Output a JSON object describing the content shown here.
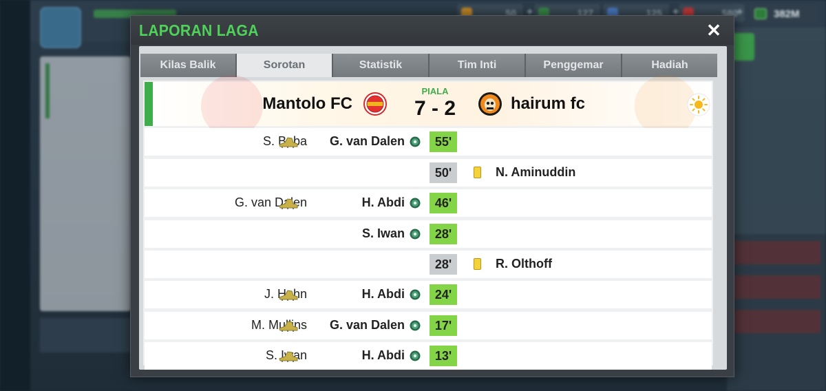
{
  "background": {
    "resources": [
      {
        "value": "50",
        "color": "#c58a2a"
      },
      {
        "value": "127",
        "color": "#3a8a4a"
      },
      {
        "value": "125",
        "color": "#4a78c0"
      },
      {
        "value": "580",
        "color": "#c03a3a"
      }
    ],
    "money": "382M"
  },
  "modal": {
    "title": "LAPORAN LAGA",
    "close_glyph": "✕",
    "tabs": [
      {
        "label": "Kilas Balik",
        "active": false
      },
      {
        "label": "Sorotan",
        "active": true
      },
      {
        "label": "Statistik",
        "active": false
      },
      {
        "label": "Tim Inti",
        "active": false
      },
      {
        "label": "Penggemar",
        "active": false
      },
      {
        "label": "Hadiah",
        "active": false
      }
    ],
    "match": {
      "home_team": "Mantolo FC",
      "away_team": "hairum fc",
      "competition": "PIALA",
      "score": "7 - 2",
      "home_crest_colors": [
        "#e53030",
        "#f2b320"
      ],
      "away_crest_colors": [
        "#f08a1c",
        "#1a1a1a"
      ],
      "weather_icon": "sun-icon"
    },
    "events": [
      {
        "type": "goal",
        "minute": "55'",
        "assist": "S. Baba",
        "scorer": "G. van Dalen"
      },
      {
        "type": "card",
        "minute": "50'",
        "player": "N. Aminuddin"
      },
      {
        "type": "goal",
        "minute": "46'",
        "assist": "G. van Dalen",
        "scorer": "H. Abdi"
      },
      {
        "type": "goal",
        "minute": "28'",
        "assist": "",
        "scorer": "S. Iwan"
      },
      {
        "type": "card",
        "minute": "28'",
        "player": "R. Olthoff"
      },
      {
        "type": "goal",
        "minute": "24'",
        "assist": "J. Hahn",
        "scorer": "H. Abdi"
      },
      {
        "type": "goal",
        "minute": "17'",
        "assist": "M. Mullins",
        "scorer": "G. van Dalen"
      },
      {
        "type": "goal",
        "minute": "13'",
        "assist": "S. Iwan",
        "scorer": "H. Abdi"
      }
    ]
  }
}
